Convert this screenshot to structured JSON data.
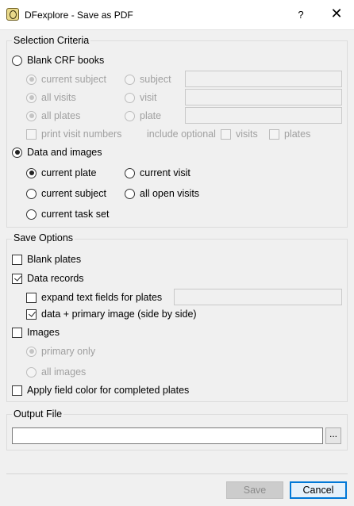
{
  "window": {
    "title": "DFexplore - Save as PDF",
    "help_label": "?",
    "close_label": "✕",
    "icon": "dfexplore-app-icon"
  },
  "selection": {
    "title": "Selection Criteria",
    "blank_crf": "Blank CRF books",
    "current_subject": "current subject",
    "subject": "subject",
    "all_visits": "all visits",
    "visit": "visit",
    "all_plates": "all plates",
    "plate": "plate",
    "print_visit_numbers": "print visit numbers",
    "include_optional": "include optional",
    "visits": "visits",
    "plates": "plates",
    "data_and_images": "Data and images",
    "current_plate": "current plate",
    "current_visit": "current visit",
    "current_subject2": "current subject",
    "all_open_visits": "all open visits",
    "current_task_set": "current task set"
  },
  "save_options": {
    "title": "Save Options",
    "blank_plates": "Blank plates",
    "data_records": "Data records",
    "expand_text_fields": "expand text fields for plates",
    "data_primary_image": "data + primary image (side by side)",
    "images": "Images",
    "primary_only": "primary only",
    "all_images": "all images",
    "apply_field_color": "Apply field color for completed plates"
  },
  "output": {
    "title": "Output File",
    "file_value": "",
    "browse_label": "..."
  },
  "buttons": {
    "save": "Save",
    "cancel": "Cancel"
  },
  "colors": {
    "accent": "#0078d7",
    "disabled_text": "#a0a0a0"
  }
}
